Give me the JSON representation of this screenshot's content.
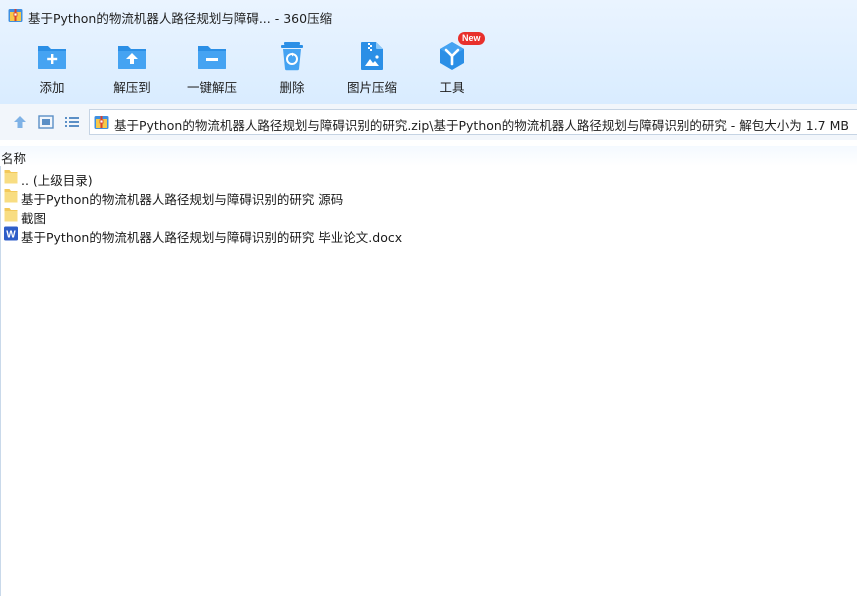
{
  "window": {
    "title": "基于Python的物流机器人路径规划与障碍... - 360压缩",
    "title_icon": "archive-icon"
  },
  "toolbar": {
    "items": [
      {
        "label": "添加",
        "icon": "add-folder-icon"
      },
      {
        "label": "解压到",
        "icon": "extract-to-icon"
      },
      {
        "label": "一键解压",
        "icon": "one-click-extract-icon"
      },
      {
        "label": "删除",
        "icon": "recycle-bin-icon"
      },
      {
        "label": "图片压缩",
        "icon": "image-compress-icon"
      },
      {
        "label": "工具",
        "icon": "tools-icon",
        "badge": "New"
      }
    ]
  },
  "navbar": {
    "address": "基于Python的物流机器人路径规划与障碍识别的研究.zip\\基于Python的物流机器人路径规划与障碍识别的研究 - 解包大小为 1.7 MB"
  },
  "filelist": {
    "column_name": "名称",
    "items": [
      {
        "name": ".. (上级目录)",
        "type": "folder"
      },
      {
        "name": "基于Python的物流机器人路径规划与障碍识别的研究 源码",
        "type": "folder"
      },
      {
        "name": "截图",
        "type": "folder"
      },
      {
        "name": "基于Python的物流机器人路径规划与障碍识别的研究 毕业论文.docx",
        "type": "word"
      }
    ]
  },
  "colors": {
    "accent_blue": "#2b8fe6",
    "folder_yellow": "#f7d774",
    "word_blue": "#2f5ec8",
    "badge_red": "#e8302c"
  }
}
